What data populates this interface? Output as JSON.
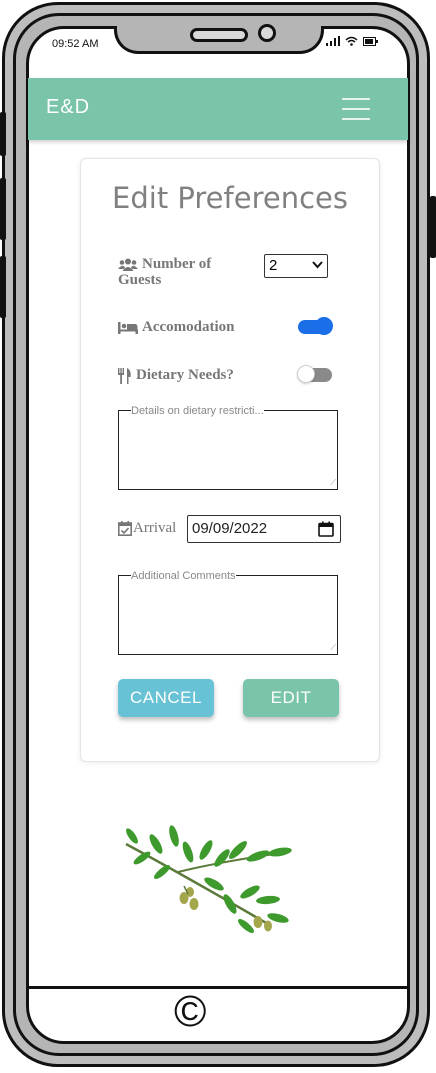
{
  "status_bar": {
    "time": "09:52 AM"
  },
  "navbar": {
    "brand": "E&D"
  },
  "form": {
    "title": "Edit Preferences",
    "guests_label": "Number of Guests",
    "guests_value": "2",
    "accommodation_label": "Accomodation",
    "accommodation_on": true,
    "dietary_label": "Dietary Needs?",
    "dietary_on": false,
    "dietary_placeholder": "Details on dietary restricti...",
    "arrival_label": "Arrival",
    "arrival_value": "09/09/2022",
    "comments_placeholder": "Additional Comments",
    "cancel_label": "CANCEL",
    "edit_label": "EDIT"
  },
  "footer": {
    "symbol": "©"
  },
  "colors": {
    "brand": "#7ac4a9",
    "cancel": "#66c2d4",
    "edit": "#7ac4a9",
    "toggle_on": "#1a6ee8"
  }
}
